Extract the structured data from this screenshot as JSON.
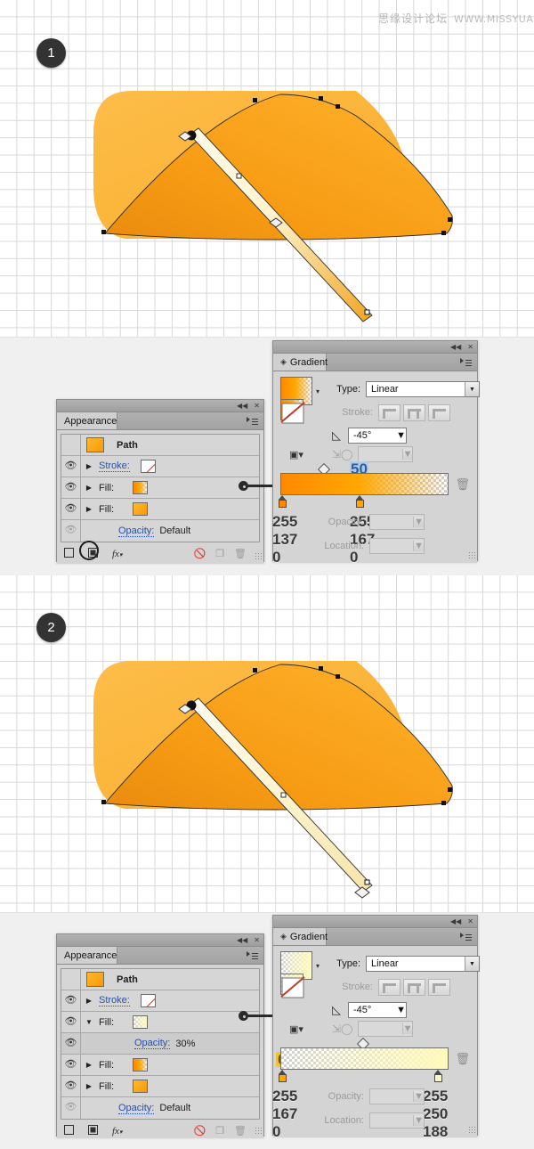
{
  "watermark": {
    "cn": "思缘设计论坛",
    "url": "WWW.MISSYUAN.COM"
  },
  "steps": [
    {
      "number": "1"
    },
    {
      "number": "2"
    }
  ],
  "panels": {
    "appearance1": {
      "tab_label": "Appearance",
      "rows": [
        {
          "eye": "",
          "arrow": "",
          "label": "Path",
          "value": "",
          "swatch": "solid-orange"
        },
        {
          "eye": "eye-icon",
          "arrow": "▶",
          "label": "Stroke:",
          "value": "",
          "swatch": "none"
        },
        {
          "eye": "eye-icon",
          "arrow": "▶",
          "label": "Fill:",
          "value": "",
          "swatch": "gradient-orange"
        },
        {
          "eye": "eye-icon",
          "arrow": "▶",
          "label": "Fill:",
          "value": "",
          "swatch": "solid-orange"
        },
        {
          "eye": "eye-icon-dim",
          "arrow": "",
          "label": "Opacity:",
          "value": "Default",
          "swatch": ""
        }
      ],
      "footer": {
        "add_new_stroke": "new-stroke-button",
        "add_new_fill": "new-fill-button",
        "fx": "fx",
        "clear": "clear-appearance-button",
        "duplicate": "duplicate-item-button",
        "delete": "delete-item-button"
      }
    },
    "gradient1": {
      "tab_label": "Gradient",
      "type_label": "Type:",
      "type_value": "Linear",
      "stroke_label": "Stroke:",
      "angle_value": "-45°",
      "opacity_label": "Opacity:",
      "opacity_value": "",
      "location_label": "Location:",
      "location_value": "",
      "annotation_location": "50",
      "annotation_zero": "0",
      "stops": [
        {
          "r": "255",
          "g": "137",
          "b": "0",
          "color": "#ff8900",
          "pos": 0
        },
        {
          "r": "255",
          "g": "167",
          "b": "0",
          "color": "#ffa700",
          "pos": 46
        }
      ]
    },
    "appearance2": {
      "tab_label": "Appearance",
      "rows": [
        {
          "eye": "",
          "arrow": "",
          "label": "Path",
          "value": "",
          "swatch": "solid-orange"
        },
        {
          "eye": "eye-icon",
          "arrow": "▶",
          "label": "Stroke:",
          "value": "",
          "swatch": "none"
        },
        {
          "eye": "eye-icon",
          "arrow": "▼",
          "label": "Fill:",
          "value": "",
          "swatch": "gradient-pale"
        },
        {
          "eye": "eye-icon",
          "arrow": "",
          "label": "Opacity:",
          "value": "30%",
          "swatch": ""
        },
        {
          "eye": "eye-icon",
          "arrow": "▶",
          "label": "Fill:",
          "value": "",
          "swatch": "gradient-orange"
        },
        {
          "eye": "eye-icon",
          "arrow": "▶",
          "label": "Fill:",
          "value": "",
          "swatch": "solid-orange"
        },
        {
          "eye": "eye-icon-dim",
          "arrow": "",
          "label": "Opacity:",
          "value": "Default",
          "swatch": ""
        }
      ]
    },
    "gradient2": {
      "tab_label": "Gradient",
      "type_label": "Type:",
      "type_value": "Linear",
      "stroke_label": "Stroke:",
      "angle_value": "-45°",
      "opacity_label": "Opacity:",
      "opacity_value": "",
      "location_label": "Location:",
      "location_value": "",
      "annotation_zero": "0",
      "stops": [
        {
          "r": "255",
          "g": "167",
          "b": "0",
          "color": "#ffa700",
          "pos": 0
        },
        {
          "r": "255",
          "g": "250",
          "b": "188",
          "color": "#fffabc",
          "pos": 100
        }
      ]
    }
  },
  "artwork": {
    "canopy_back_color": "#fcb73c",
    "canopy_front_light": "#ffad1f",
    "canopy_front_dark": "#ef8f12",
    "pole_light": "#fff6d8",
    "pole_dark": "#f2a01c"
  }
}
